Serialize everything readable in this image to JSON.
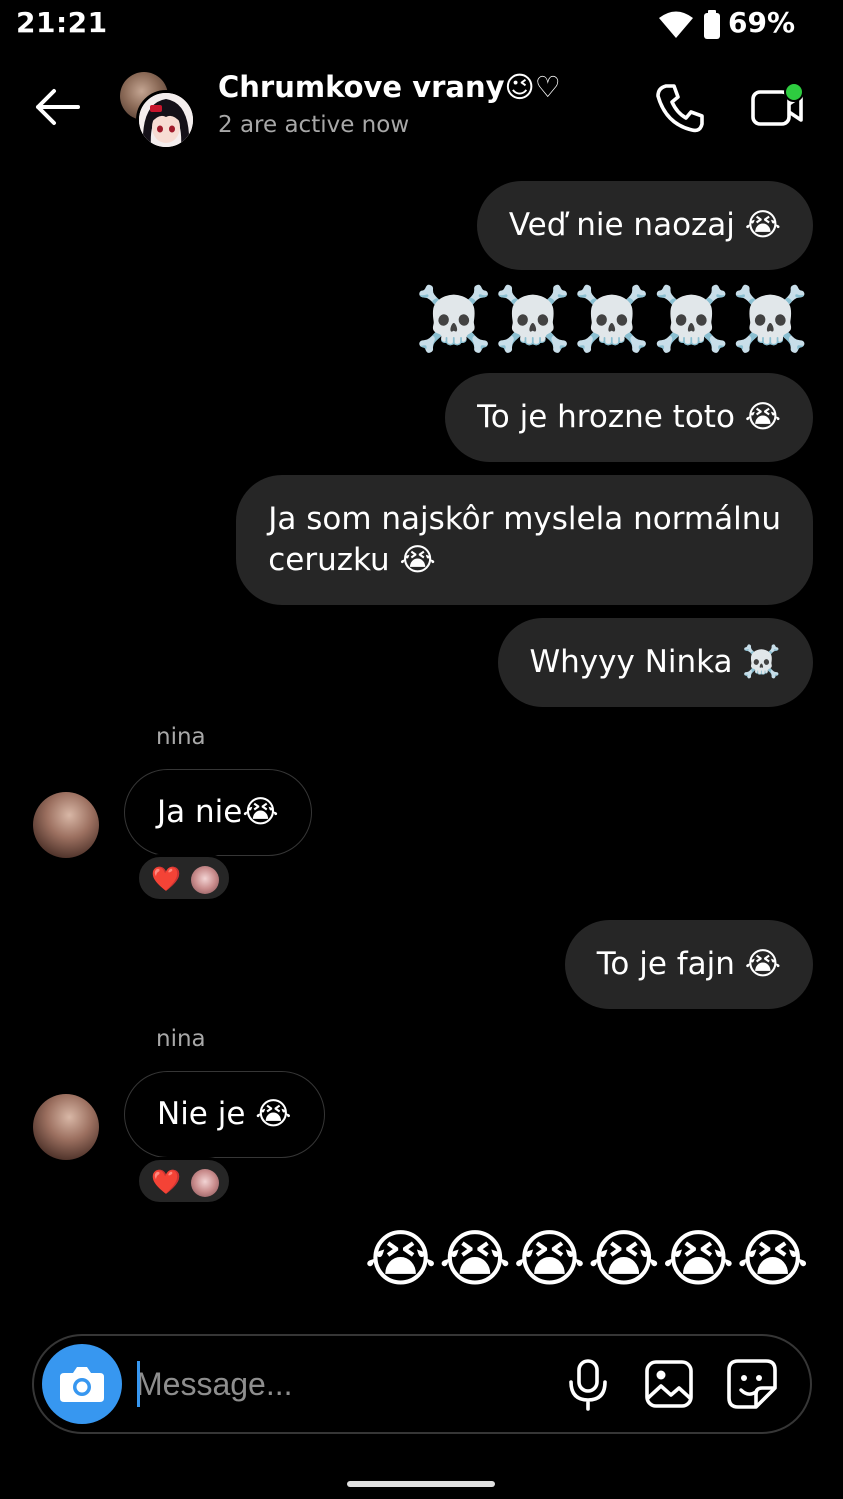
{
  "status_bar": {
    "time": "21:21",
    "battery": "69%",
    "icons": [
      "wifi-icon",
      "battery-icon"
    ]
  },
  "header": {
    "title": "Chrumkove vrany😉♡",
    "subtitle": "2 are active now",
    "icons": [
      "back-arrow-icon",
      "phone-icon",
      "video-icon"
    ],
    "online_indicator_color": "#2ecc40"
  },
  "messages": [
    {
      "id": "m1",
      "direction": "outgoing",
      "text": "Veď nie naozaj 😭"
    },
    {
      "id": "m2",
      "direction": "outgoing",
      "text": "☠️☠️☠️☠️☠️"
    },
    {
      "id": "m3",
      "direction": "outgoing",
      "text": "To je hrozne toto 😭"
    },
    {
      "id": "m4",
      "direction": "outgoing",
      "line1": "Ja som najskôr myslela normálnu",
      "line2": "ceruzku 😭"
    },
    {
      "id": "m5",
      "direction": "outgoing",
      "text": "Whyyy Ninka ☠️"
    },
    {
      "id": "m6",
      "direction": "incoming",
      "sender": "nina",
      "text": "Ja nie😭",
      "reaction": "❤️"
    },
    {
      "id": "m7",
      "direction": "outgoing",
      "text": "To je fajn 😭"
    },
    {
      "id": "m8",
      "direction": "incoming",
      "sender": "nina",
      "text": "Nie je 😭",
      "reaction": "❤️"
    },
    {
      "id": "m9",
      "direction": "outgoing",
      "text": "😭😭😭😭😭😭"
    }
  ],
  "composer": {
    "placeholder": "Message...",
    "icons": [
      "camera-icon",
      "microphone-icon",
      "gallery-icon",
      "sticker-icon"
    ]
  },
  "colors": {
    "background": "#000000",
    "bubble_outgoing": "#262626",
    "accent": "#3797f0",
    "secondary_text": "#a8a8a8"
  }
}
